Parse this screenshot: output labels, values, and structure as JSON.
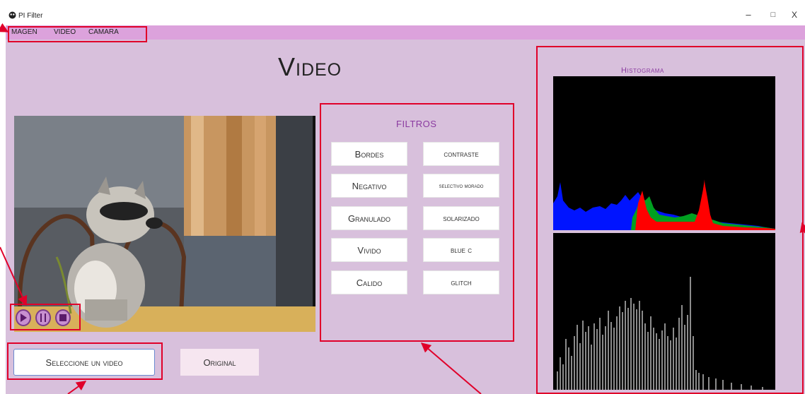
{
  "window": {
    "title": "PI Filter",
    "minimize": "–",
    "maximize": "□",
    "close": "X"
  },
  "menu": [
    "MAGEN",
    "VIDEO",
    "CAMARA"
  ],
  "page_title": "Video",
  "player": {
    "play_icon": "play-icon",
    "pause_icon": "pause-icon",
    "stop_icon": "stop-icon"
  },
  "filters": {
    "title": "FILTROS",
    "left": [
      "Bordes",
      "Negativo",
      "Granulado",
      "Vivido",
      "Calido"
    ],
    "right": [
      "contraste",
      "selectivo morado",
      "solarizado",
      "blue c",
      "glitch"
    ]
  },
  "buttons": {
    "select_video": "Seleccione un video",
    "original": "Original"
  },
  "histogram": {
    "title": "Histograma"
  },
  "colors": {
    "background": "#d8c0dc",
    "menubar": "#dca2dc",
    "accent": "#8a3aa0",
    "annotation": "#e0002a"
  }
}
